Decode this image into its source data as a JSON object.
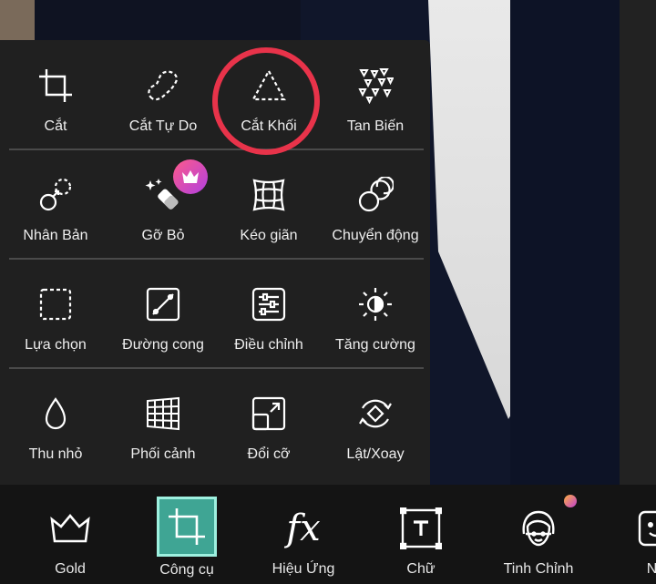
{
  "tools_panel": {
    "rows": [
      [
        {
          "label": "Cắt",
          "icon": "crop-icon"
        },
        {
          "label": "Cắt Tự Do",
          "icon": "freeform-cut-icon"
        },
        {
          "label": "Cắt Khối",
          "icon": "shape-cut-icon"
        },
        {
          "label": "Tan Biến",
          "icon": "dispersion-icon"
        }
      ],
      [
        {
          "label": "Nhân Bản",
          "icon": "clone-icon"
        },
        {
          "label": "Gỡ Bỏ",
          "icon": "remove-icon"
        },
        {
          "label": "Kéo giãn",
          "icon": "stretch-icon"
        },
        {
          "label": "Chuyển động",
          "icon": "motion-icon"
        }
      ],
      [
        {
          "label": "Lựa chọn",
          "icon": "selection-icon"
        },
        {
          "label": "Đường cong",
          "icon": "curves-icon"
        },
        {
          "label": "Điều chỉnh",
          "icon": "adjust-icon"
        },
        {
          "label": "Tăng cường",
          "icon": "enhance-icon"
        }
      ],
      [
        {
          "label": "Thu nhỏ",
          "icon": "shrink-icon"
        },
        {
          "label": "Phối cảnh",
          "icon": "perspective-icon"
        },
        {
          "label": "Đổi cỡ",
          "icon": "resize-icon"
        },
        {
          "label": "Lật/Xoay",
          "icon": "flip-rotate-icon"
        }
      ]
    ],
    "premium_badge_icon": "crown-icon",
    "highlight_color": "#e8334a"
  },
  "bottom_toolbar": {
    "items": [
      {
        "label": "Gold",
        "icon": "crown-outline-icon"
      },
      {
        "label": "Công cụ",
        "icon": "crop-tools-icon",
        "active": true
      },
      {
        "label": "Hiệu Ứng",
        "icon": "fx-icon"
      },
      {
        "label": "Chữ",
        "icon": "text-icon"
      },
      {
        "label": "Tinh Chỉnh",
        "icon": "face-retouch-icon"
      },
      {
        "label": "Nh",
        "icon": "sticker-icon"
      }
    ],
    "active_color": "#3fa594"
  }
}
